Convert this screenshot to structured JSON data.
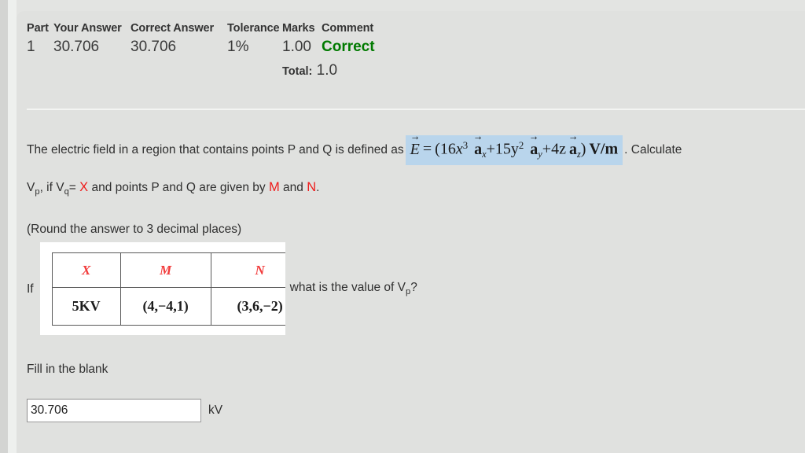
{
  "results": {
    "headers": {
      "part": "Part",
      "your_answer": "Your Answer",
      "correct_answer": "Correct Answer",
      "tolerance": "Tolerance",
      "marks": "Marks",
      "comment": "Comment"
    },
    "row": {
      "part": "1",
      "your_answer": "30.706",
      "correct_answer": "30.706",
      "tolerance": "1%",
      "marks": "1.00",
      "comment": "Correct"
    },
    "total_label": "Total:",
    "total_value": "1.0",
    "correct_color": "#007a00"
  },
  "question": {
    "line1_prefix": "The electric field in a region that contains points P and Q is defined as",
    "line1_suffix": ". Calculate",
    "formula": {
      "lhs": "E",
      "full_text": "E⃗ = (16x³ a⃗x + 15y² a⃗y + 4z a⃗z) V/m",
      "open_paren": "(",
      "term1_coeff": "16",
      "term1_var": "x",
      "term1_exp": "3",
      "term1_unit_sub": "x",
      "plus1": "+",
      "term2_coeff": "15",
      "term2_var": "y",
      "term2_exp": "2",
      "term2_unit_sub": "y",
      "plus2": "+",
      "term3_coeff": "4",
      "term3_var": "z",
      "term3_unit_sub": "z",
      "close_paren": ")",
      "units": "V/m",
      "vector_letter": "a",
      "equals": "=",
      "highlight_color": "#b9d5ec"
    },
    "line2_a": "V",
    "line2_a_sub": "p",
    "line2_b": ", if V",
    "line2_b_sub": "q",
    "line2_c": "= ",
    "line2_var_x": "X",
    "line2_d": " and points P and Q are given by ",
    "line2_var_m": "M",
    "line2_e": " and ",
    "line2_var_n": "N",
    "line2_f": ".",
    "round_note": "(Round the answer to 3 decimal places)",
    "variable_color": "#ee1c1c"
  },
  "value_table": {
    "if_label": "If",
    "headers": [
      "X",
      "M",
      "N"
    ],
    "values": [
      "5KV",
      "(4,−4,1)",
      "(3,6,−2)"
    ],
    "trailing_text": "what is the value of V",
    "trailing_sub": "p",
    "trailing_suffix": "?",
    "header_color": "#f23b3b"
  },
  "answer": {
    "prompt": "Fill in the blank",
    "value": "30.706",
    "placeholder": "",
    "unit": "kV"
  }
}
